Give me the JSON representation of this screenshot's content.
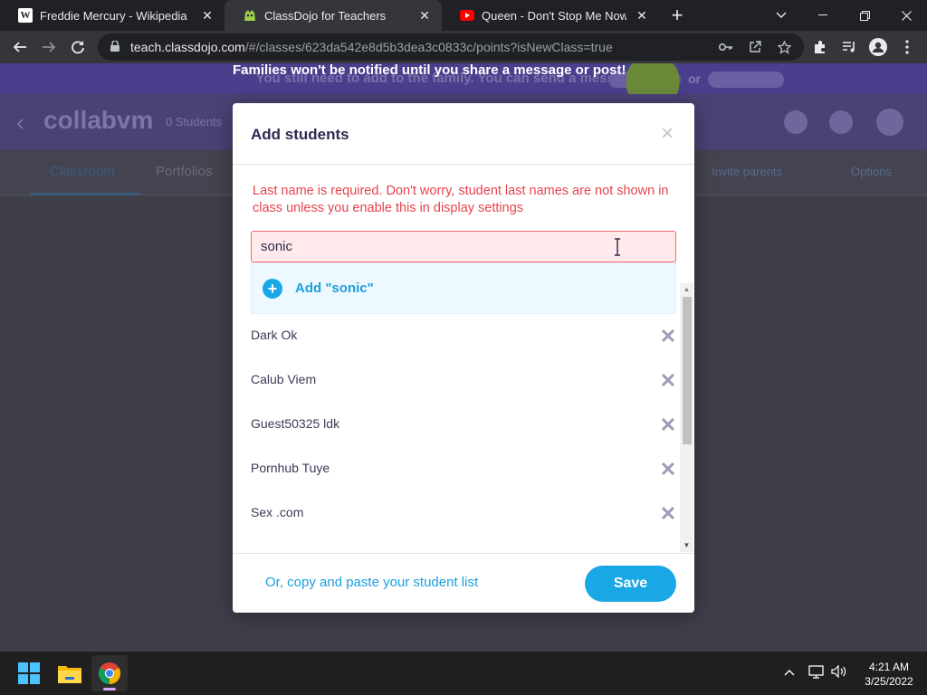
{
  "browser": {
    "tabs": [
      {
        "title": "Freddie Mercury - Wikipedia",
        "favicon": "W",
        "active": false
      },
      {
        "title": "ClassDojo for Teachers",
        "favicon": "classdojo-icon",
        "active": true
      },
      {
        "title": "Queen - Don't Stop Me Now (Offi",
        "favicon": "youtube-icon",
        "active": false
      }
    ],
    "tab_close": "✕",
    "new_tab": "+",
    "url_host": "teach.classdojo.com",
    "url_path": "/#/classes/623da542e8d5b3dea3c0833c/points?isNewClass=true"
  },
  "page": {
    "banner_text": "You still need to add to the family. You can send a message after",
    "banner_fg_text": "Families won't be notified until you share a message or post!",
    "banner_or": "or",
    "class_title": "collabvm",
    "class_subtitle": "0 Students",
    "nav": {
      "classroom": "Classroom",
      "portfolios": "Portfolios",
      "right1": "Invite parents",
      "right2": "Options"
    }
  },
  "modal": {
    "title": "Add students",
    "close": "×",
    "error": "Last name is required. Don't worry, student last names are not shown in class unless you enable this in display settings",
    "input_value": "sonic",
    "suggestion": "Add \"sonic\"",
    "students": [
      {
        "name": "Dark Ok"
      },
      {
        "name": "Calub Viem"
      },
      {
        "name": "Guest50325 ldk"
      },
      {
        "name": "Pornhub Tuye"
      },
      {
        "name": "Sex .com"
      }
    ],
    "remove_glyph": "✕",
    "copy_link": "Or, copy and paste your student list",
    "save": "Save"
  },
  "taskbar": {
    "time": "4:21 AM",
    "date": "3/25/2022"
  },
  "colors": {
    "accent": "#1aa7e6",
    "error": "#e8434c",
    "error_bg": "#ffe9ea"
  }
}
